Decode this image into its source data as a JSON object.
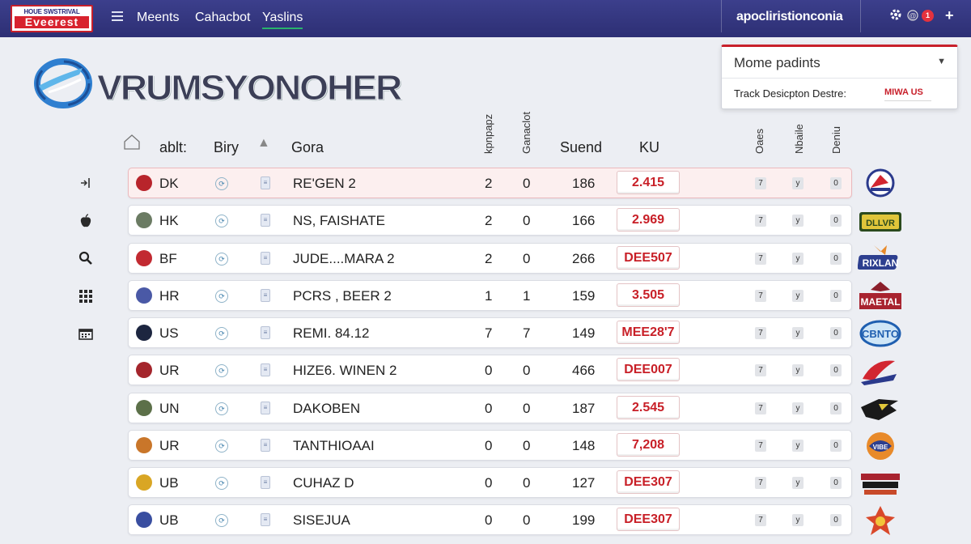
{
  "header": {
    "brand_line1": "HOUE SWSTRIVAL",
    "brand_line2": "Eveerest",
    "nav": [
      "Meents",
      "Cahacbot",
      "Yaslins"
    ],
    "domain": "apocliristionconia",
    "notification_count": "1"
  },
  "logo_text": "VRUMSYONOHER",
  "panel": {
    "title": "Mome padints",
    "label": "Track Desicpton Destre:",
    "tag": "MIWA US"
  },
  "columns": {
    "c1": "ablt:",
    "c2": "Biry",
    "c3": "Gora",
    "v1": "kpnpapz",
    "v2": "Ganaclot",
    "c4": "Suend",
    "c5": "KU",
    "v3": "Oaes",
    "v4": "Nbaile",
    "v5": "Deniu"
  },
  "rows": [
    {
      "code": "DK",
      "name": "RE'GEN 2",
      "a": "2",
      "b": "0",
      "n": "186",
      "score": "2.415",
      "badge": "#b8242b"
    },
    {
      "code": "HK",
      "name": "NS, FAISHATE",
      "a": "2",
      "b": "0",
      "n": "166",
      "score": "2.969",
      "badge": "#6b7b63"
    },
    {
      "code": "BF",
      "name": "JUDE....MARA 2",
      "a": "2",
      "b": "0",
      "n": "266",
      "score": "DEE507",
      "badge": "#c22a31"
    },
    {
      "code": "HR",
      "name": "PCRS , BEER 2",
      "a": "1",
      "b": "1",
      "n": "159",
      "score": "3.505",
      "badge": "#4a59a6"
    },
    {
      "code": "US",
      "name": "REMI. 84.12",
      "a": "7",
      "b": "7",
      "n": "149",
      "score": "MEE28'7",
      "badge": "#1d2640"
    },
    {
      "code": "UR",
      "name": "HIZE6. WINEN 2",
      "a": "0",
      "b": "0",
      "n": "466",
      "score": "DEE007",
      "badge": "#a4252c"
    },
    {
      "code": "UN",
      "name": "DAKOBEN",
      "a": "0",
      "b": "0",
      "n": "187",
      "score": "2.545",
      "badge": "#5c7049"
    },
    {
      "code": "UR",
      "name": "TANTHIOAAI",
      "a": "0",
      "b": "0",
      "n": "148",
      "score": "7,208",
      "badge": "#c9762a"
    },
    {
      "code": "UB",
      "name": "CUHAZ D",
      "a": "0",
      "b": "0",
      "n": "127",
      "score": "DEE307",
      "badge": "#d9a624"
    },
    {
      "code": "UB",
      "name": "SISEJUA",
      "a": "0",
      "b": "0",
      "n": "199",
      "score": "DEE307",
      "badge": "#394ea0"
    }
  ],
  "chip_values": [
    "7",
    "y",
    "0"
  ],
  "icons": {
    "sidebar": [
      "exit-icon",
      "apple-icon",
      "search-icon",
      "grid-icon",
      "calendar-icon"
    ],
    "topbar": [
      "gear-icon",
      "help-icon",
      "plus-icon"
    ]
  },
  "colors": {
    "topbar": "#2d2f74",
    "accent": "#c8202b",
    "active_nav": "#29b36b"
  }
}
